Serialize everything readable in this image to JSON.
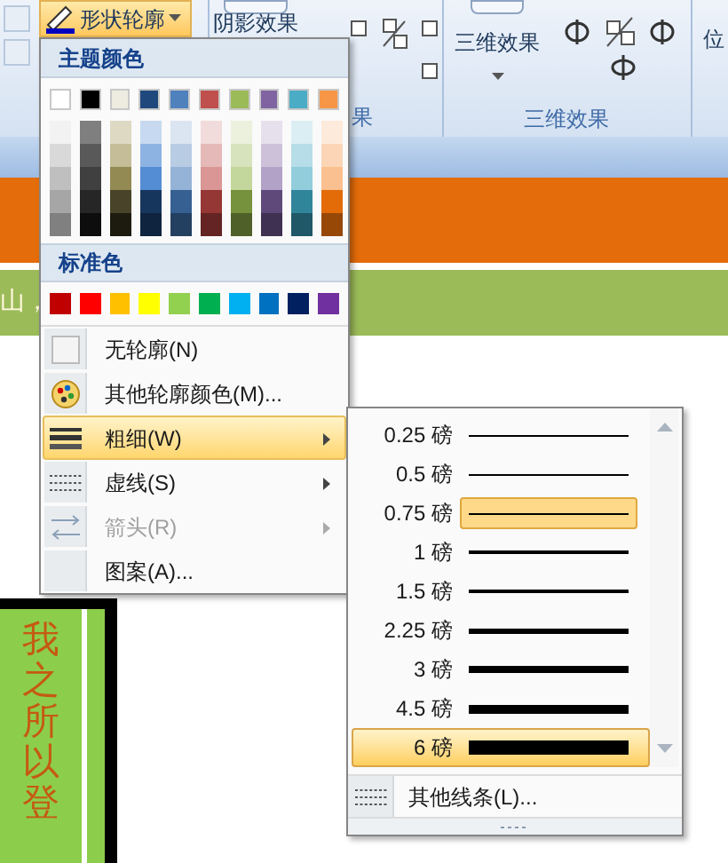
{
  "ribbon": {
    "shape_outline_button": {
      "label": "形状轮廓",
      "selected": true
    },
    "shadow_button": {
      "label": "阴影效果"
    },
    "shadow_group_label": "果",
    "three_d_button": {
      "label": "三维效果"
    },
    "three_d_group_label": "三维效果",
    "position_button": {
      "label": "位"
    }
  },
  "document": {
    "banner_text": "山，",
    "text_box": "我之所以登"
  },
  "outline_menu": {
    "theme_header": "主题颜色",
    "theme_colors": [
      {
        "color": "#ffffff",
        "shades": [
          {
            "color": "#f2f2f2"
          },
          {
            "color": "#d9d9d9"
          },
          {
            "color": "#bfbfbf"
          },
          {
            "color": "#a6a6a6"
          },
          {
            "color": "#808080"
          }
        ]
      },
      {
        "color": "#000000",
        "shades": [
          {
            "color": "#7f7f7f"
          },
          {
            "color": "#595959"
          },
          {
            "color": "#404040"
          },
          {
            "color": "#262626"
          },
          {
            "color": "#0d0d0d"
          }
        ]
      },
      {
        "color": "#eeece1",
        "shades": [
          {
            "color": "#ddd9c3"
          },
          {
            "color": "#c4bd97"
          },
          {
            "color": "#938953"
          },
          {
            "color": "#494429"
          },
          {
            "color": "#1d1b10"
          }
        ]
      },
      {
        "color": "#1f497d",
        "shades": [
          {
            "color": "#c6d9f0"
          },
          {
            "color": "#8db3e2"
          },
          {
            "color": "#548dd4"
          },
          {
            "color": "#17365d"
          },
          {
            "color": "#0f243e"
          }
        ]
      },
      {
        "color": "#4f81bd",
        "shades": [
          {
            "color": "#dbe5f1"
          },
          {
            "color": "#b8cce4"
          },
          {
            "color": "#95b3d7"
          },
          {
            "color": "#366092"
          },
          {
            "color": "#244061"
          }
        ]
      },
      {
        "color": "#c0504d",
        "shades": [
          {
            "color": "#f2dcdb"
          },
          {
            "color": "#e5b9b7"
          },
          {
            "color": "#d99694"
          },
          {
            "color": "#953734"
          },
          {
            "color": "#632423"
          }
        ]
      },
      {
        "color": "#9bbb59",
        "shades": [
          {
            "color": "#ebf1dd"
          },
          {
            "color": "#d7e3bc"
          },
          {
            "color": "#c3d69b"
          },
          {
            "color": "#76923c"
          },
          {
            "color": "#4f6128"
          }
        ]
      },
      {
        "color": "#8064a2",
        "shades": [
          {
            "color": "#e5e0ec"
          },
          {
            "color": "#ccc1d9"
          },
          {
            "color": "#b2a2c7"
          },
          {
            "color": "#5f497a"
          },
          {
            "color": "#3f3151"
          }
        ]
      },
      {
        "color": "#4bacc6",
        "shades": [
          {
            "color": "#dbeef3"
          },
          {
            "color": "#b7dde8"
          },
          {
            "color": "#92cddc"
          },
          {
            "color": "#31859b"
          },
          {
            "color": "#205867"
          }
        ]
      },
      {
        "color": "#f79646",
        "shades": [
          {
            "color": "#fdeada"
          },
          {
            "color": "#fbd5b5"
          },
          {
            "color": "#fac08f"
          },
          {
            "color": "#e36c09"
          },
          {
            "color": "#974806"
          }
        ]
      }
    ],
    "standard_header": "标准色",
    "standard_colors": [
      {
        "color": "#c00000"
      },
      {
        "color": "#ff0000"
      },
      {
        "color": "#ffc000"
      },
      {
        "color": "#ffff00"
      },
      {
        "color": "#92d050"
      },
      {
        "color": "#00b050"
      },
      {
        "color": "#00b0f0"
      },
      {
        "color": "#0070c0"
      },
      {
        "color": "#002060"
      },
      {
        "color": "#7030a0"
      }
    ],
    "items": [
      {
        "kind": "no-outline",
        "label": "无轮廓(N)",
        "selected": false,
        "disabled": false,
        "submenu": false
      },
      {
        "kind": "more-colors",
        "label": "其他轮廓颜色(M)...",
        "selected": false,
        "disabled": false,
        "submenu": false
      },
      {
        "kind": "weight",
        "label": "粗细(W)",
        "selected": true,
        "disabled": false,
        "submenu": true
      },
      {
        "kind": "dashes",
        "label": "虚线(S)",
        "selected": false,
        "disabled": false,
        "submenu": true
      },
      {
        "kind": "arrows",
        "label": "箭头(R)",
        "selected": false,
        "disabled": true,
        "submenu": true
      },
      {
        "kind": "pattern",
        "label": "图案(A)...",
        "selected": false,
        "disabled": false,
        "submenu": false
      }
    ]
  },
  "weight_menu": {
    "items": [
      {
        "label": "0.25 磅",
        "selected": false,
        "hovered": false
      },
      {
        "label": "0.5 磅",
        "selected": false,
        "hovered": false
      },
      {
        "label": "0.75 磅",
        "selected": true,
        "hovered": false
      },
      {
        "label": "1 磅",
        "selected": false,
        "hovered": false
      },
      {
        "label": "1.5 磅",
        "selected": false,
        "hovered": false
      },
      {
        "label": "2.25 磅",
        "selected": false,
        "hovered": false
      },
      {
        "label": "3 磅",
        "selected": false,
        "hovered": false
      },
      {
        "label": "4.5 磅",
        "selected": false,
        "hovered": false
      },
      {
        "label": "6 磅",
        "selected": false,
        "hovered": true
      }
    ],
    "more_item": {
      "label": "其他线条(L)..."
    }
  }
}
